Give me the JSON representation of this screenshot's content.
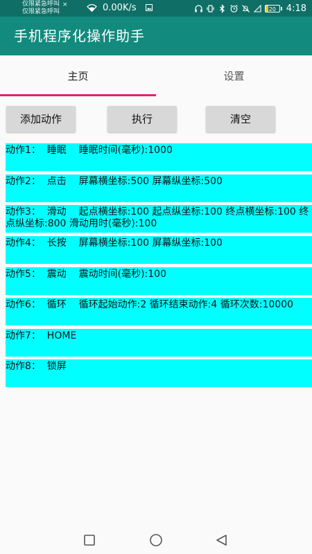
{
  "status_bar": {
    "emergency_line1": "仅限紧急呼叫",
    "emergency_line2": "仅限紧急呼叫",
    "close_mark": "×",
    "net_speed": "0.00K/s",
    "battery_level": "20",
    "time": "4:18"
  },
  "app_bar": {
    "title": "手机程序化操作助手"
  },
  "tabs": [
    {
      "label": "主页",
      "selected": true
    },
    {
      "label": "设置",
      "selected": false
    }
  ],
  "buttons": {
    "add": "添加动作",
    "run": "执行",
    "clear": "清空"
  },
  "actions": [
    {
      "text": "动作1：  睡眠    睡眠时间(毫秒):1000"
    },
    {
      "text": "动作2：  点击    屏幕横坐标:500 屏幕纵坐标:500"
    },
    {
      "text": "动作3：  滑动    起点横坐标:100 起点纵坐标:100 终点横坐标:100 终点纵坐标:800 滑动用时(毫秒):100"
    },
    {
      "text": "动作4：  长按    屏幕横坐标:100 屏幕纵坐标:100"
    },
    {
      "text": "动作5：  震动    震动时间(毫秒):100"
    },
    {
      "text": "动作6：  循环    循环起始动作:2 循环结束动作:4 循环次数:10000"
    },
    {
      "text": "动作7：  HOME"
    },
    {
      "text": "动作8：  锁屏"
    }
  ],
  "colors": {
    "status_bar": "#0f6f67",
    "app_bar": "#138a7e",
    "tab_indicator": "#e0246a",
    "action_background": "#00ffff",
    "button_background": "#d8d8d8"
  }
}
